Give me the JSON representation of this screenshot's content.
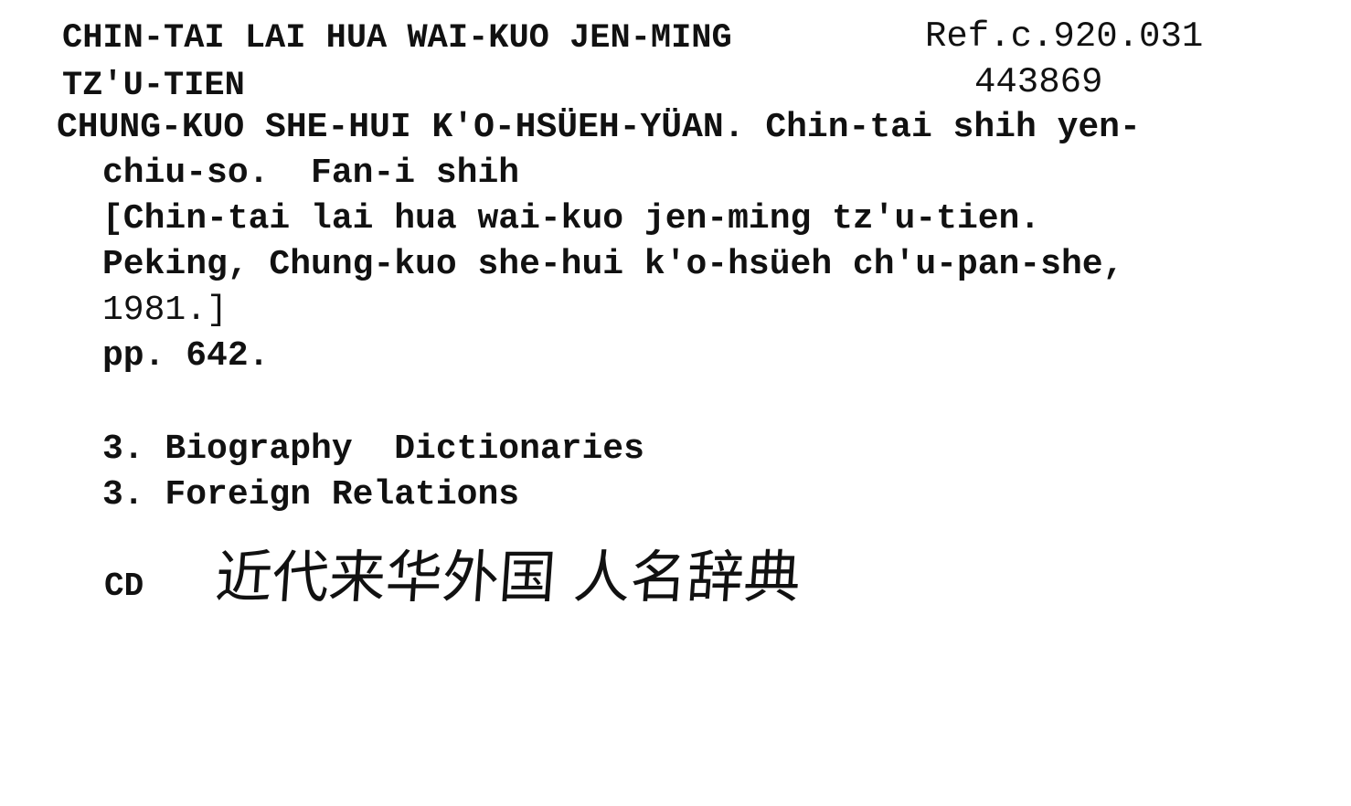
{
  "card": {
    "heading": {
      "title_line_1": "CHIN-TAI LAI HUA WAI-KUO JEN-MING",
      "title_line_2": "TZ'U-TIEN",
      "call_number": "Ref.c.920.031",
      "accession_number": "443869"
    },
    "entry": {
      "author_line_1": "CHUNG-KUO SHE-HUI K'O-HSÜEH-YÜAN. Chin-tai shih yen-",
      "author_line_2": "chiu-so.  Fan-i shih",
      "title_line_1": "[Chin-tai lai hua wai-kuo jen-ming tz'u-tien.",
      "title_line_2": "Peking, Chung-kuo she-hui k'o-hsüeh ch'u-pan-she,",
      "title_line_3": "1981.]",
      "pagination": "pp. 642."
    },
    "subjects": [
      "3. Biography  Dictionaries",
      "3. Foreign Relations"
    ],
    "cd_label": "CD",
    "chinese_title": "近代来华外国 人名辞典"
  }
}
